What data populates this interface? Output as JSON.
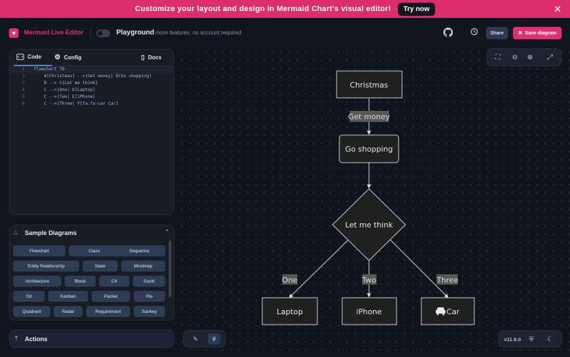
{
  "banner": {
    "text": "Customize your layout and design in Mermaid Chart's visual editor!",
    "cta": "Try now"
  },
  "header": {
    "app_title": "Mermaid Live Editor",
    "playground_label": "Playground",
    "playground_sub": "- more features, no account required",
    "share_label": "Share",
    "save_label": "Save diagram"
  },
  "editor": {
    "tabs": {
      "code": "Code",
      "config": "Config",
      "docs": "Docs"
    },
    "lines": [
      {
        "num": "1",
        "text": "flowchart TD"
      },
      {
        "num": "2",
        "text": "    A[Christmas] -->|Get money| B(Go shopping)"
      },
      {
        "num": "3",
        "text": "    B --> C{Let me think}"
      },
      {
        "num": "4",
        "text": "    C -->|One| D[Laptop]"
      },
      {
        "num": "5",
        "text": "    C -->|Two| E[iPhone]"
      },
      {
        "num": "6",
        "text": "    C -->|Three| F[fa:fa-car Car]"
      }
    ]
  },
  "samples": {
    "title": "Sample Diagrams",
    "items": [
      "Flowchart",
      "Class",
      "Sequence",
      "Entity Relationship",
      "State",
      "Mindmap",
      "Architecture",
      "Block",
      "C4",
      "Gantt",
      "Git",
      "Kanban",
      "Packet",
      "Pie",
      "Quadrant",
      "Radar",
      "Requirement",
      "Sankey"
    ]
  },
  "actions": {
    "label": "Actions"
  },
  "version": "v11.9.0",
  "diagram": {
    "nodes": {
      "christmas": "Christmas",
      "shopping": "Go shopping",
      "think": "Let me think",
      "laptop": "Laptop",
      "iphone": "iPhone",
      "car": "Car"
    },
    "edge_labels": {
      "get_money": "Get money",
      "one": "One",
      "two": "Two",
      "three": "Three"
    }
  },
  "colors": {
    "accent": "#e0306e",
    "button": "#2e3d54"
  }
}
